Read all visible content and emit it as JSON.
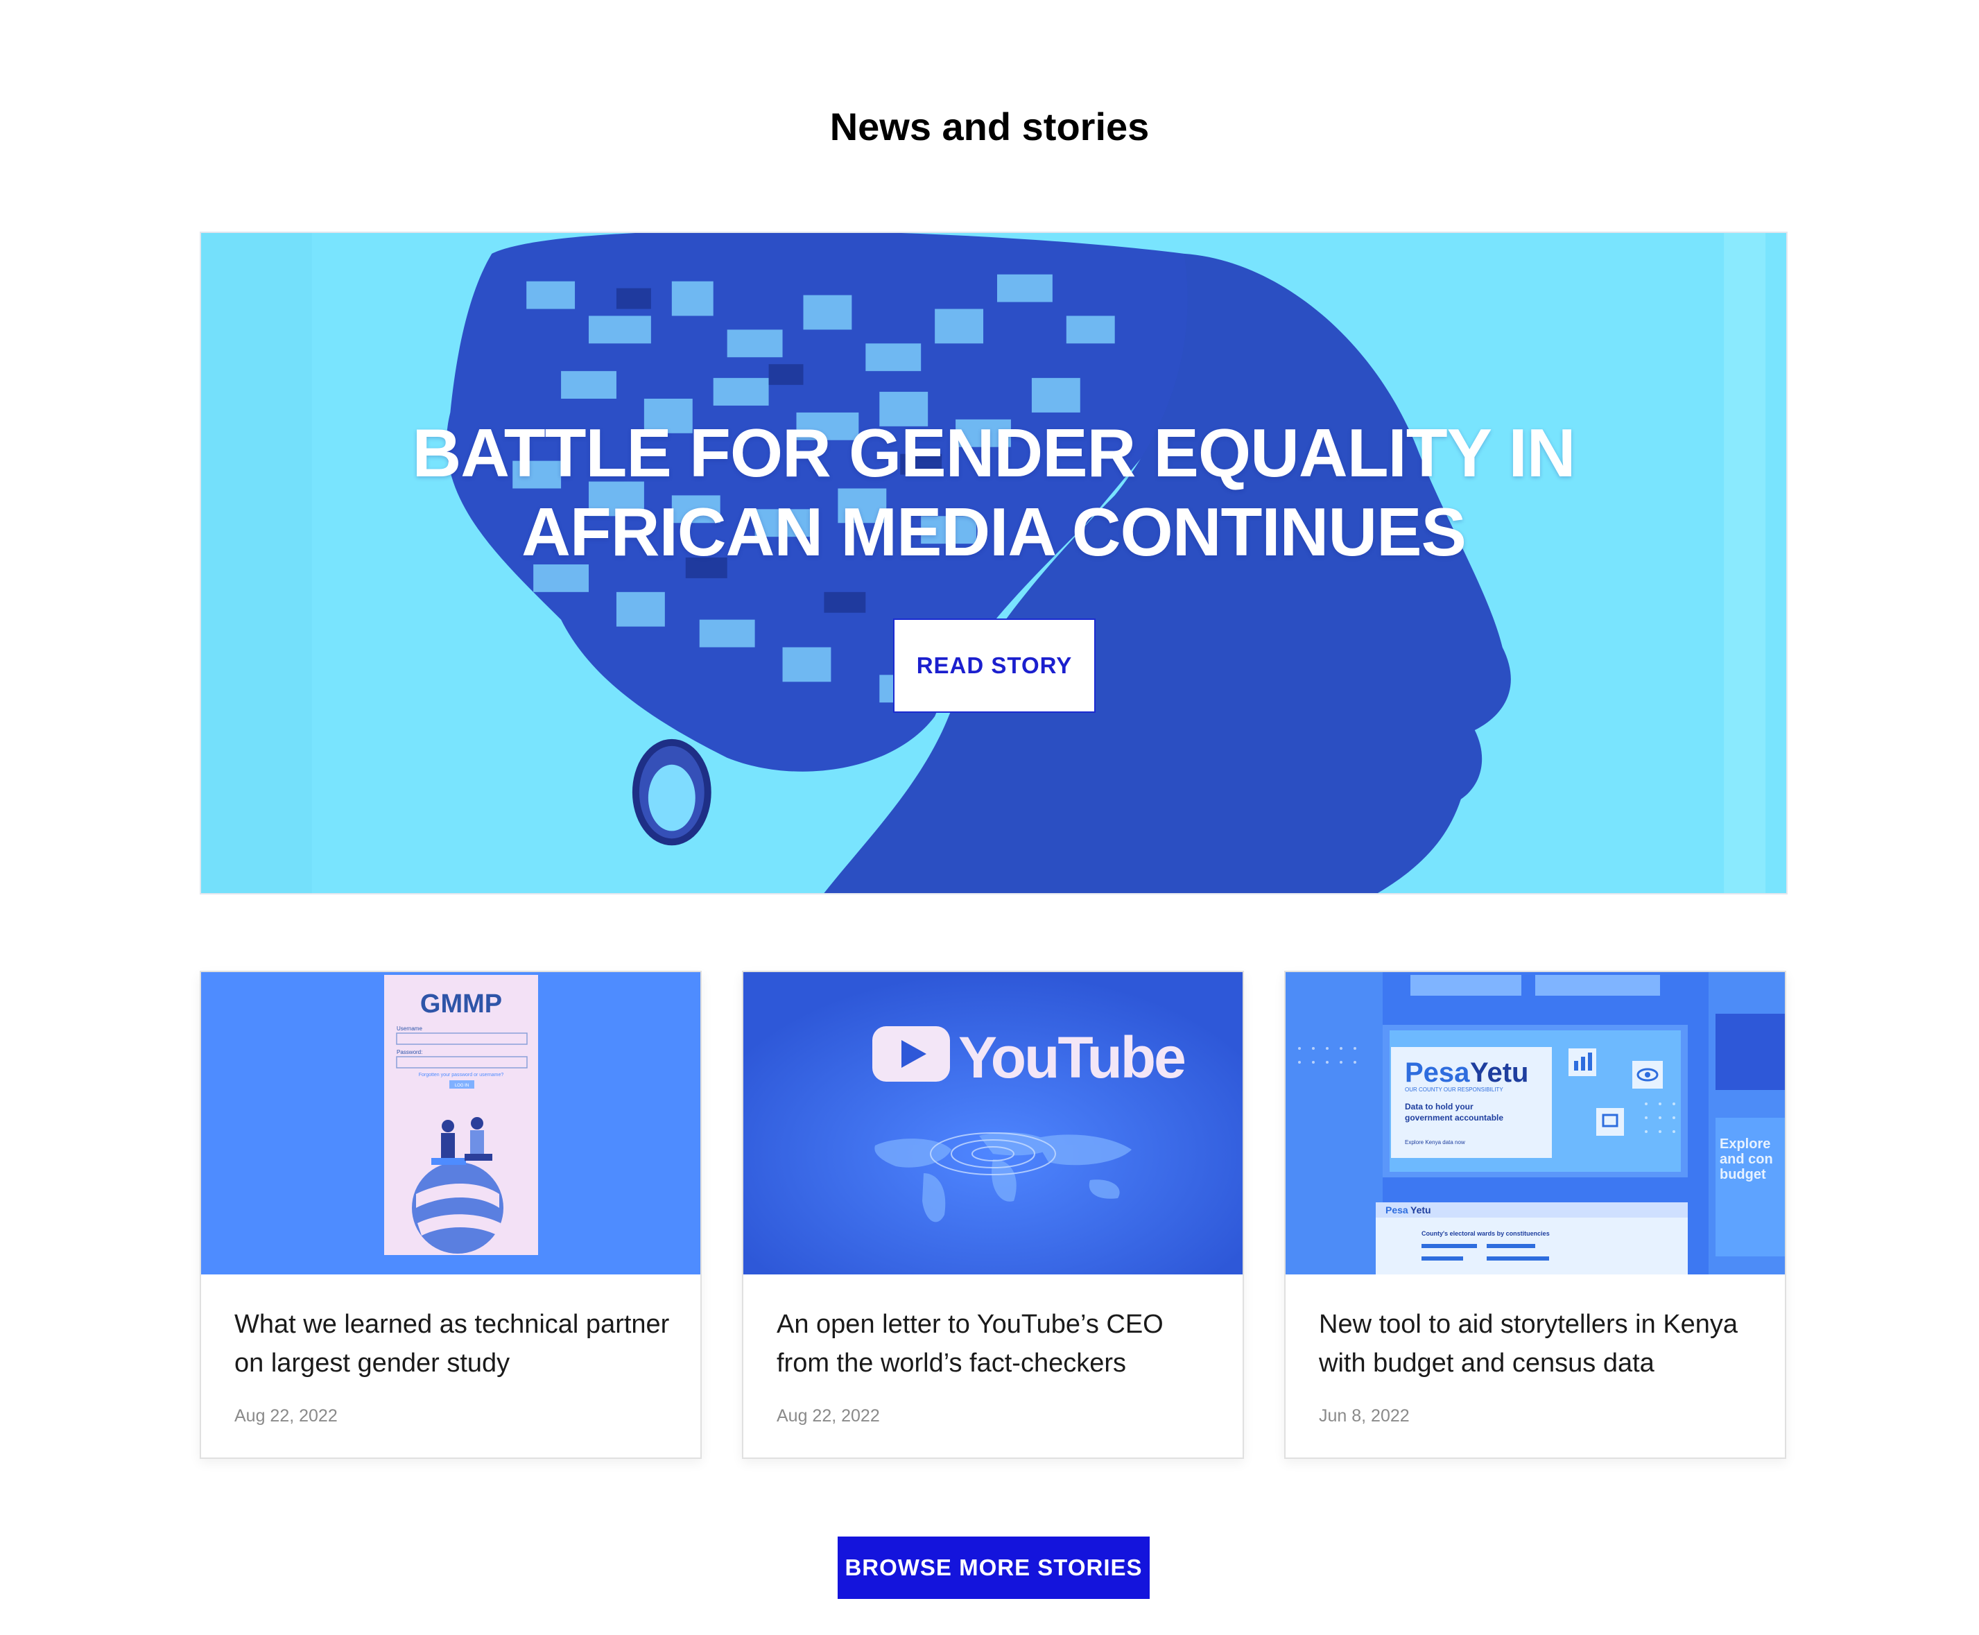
{
  "section": {
    "title": "News and stories"
  },
  "hero": {
    "title_line1": "BATTLE FOR GENDER EQUALITY IN",
    "title_line2": "AFRICAN MEDIA CONTINUES",
    "button_label": "READ STORY"
  },
  "cards": [
    {
      "thumb_logo": "GMMP",
      "thumb_fields": [
        "Username",
        "Password:"
      ],
      "thumb_link": "Forgotten your password or username?",
      "thumb_button": "LOG IN",
      "title": "What we learned as technical partner on largest gender study",
      "date": "Aug 22, 2022"
    },
    {
      "thumb_logo": "YouTube",
      "title": "An open letter to YouTube’s CEO from the world’s fact-checkers",
      "date": "Aug 22, 2022"
    },
    {
      "thumb_logo_a": "Pesa",
      "thumb_logo_b": "Yetu",
      "thumb_tagline": "OUR COUNTY OUR RESPONSIBILITY",
      "thumb_line1": "Data to hold your",
      "thumb_line2": "government accountable",
      "thumb_cta": "Explore Kenya data now",
      "thumb_side": [
        "Explore",
        "and con",
        "budget"
      ],
      "thumb_table": "County's electoral wards by constituencies",
      "title": "New tool to aid storytellers in Kenya with budget and census data",
      "date": "Jun 8, 2022"
    }
  ],
  "browse": {
    "label": "BROWSE MORE STORIES"
  },
  "colors": {
    "accent": "#1414dc",
    "hero_bg": "#7ae6ff",
    "duotone_dark": "#2a4fc4"
  }
}
